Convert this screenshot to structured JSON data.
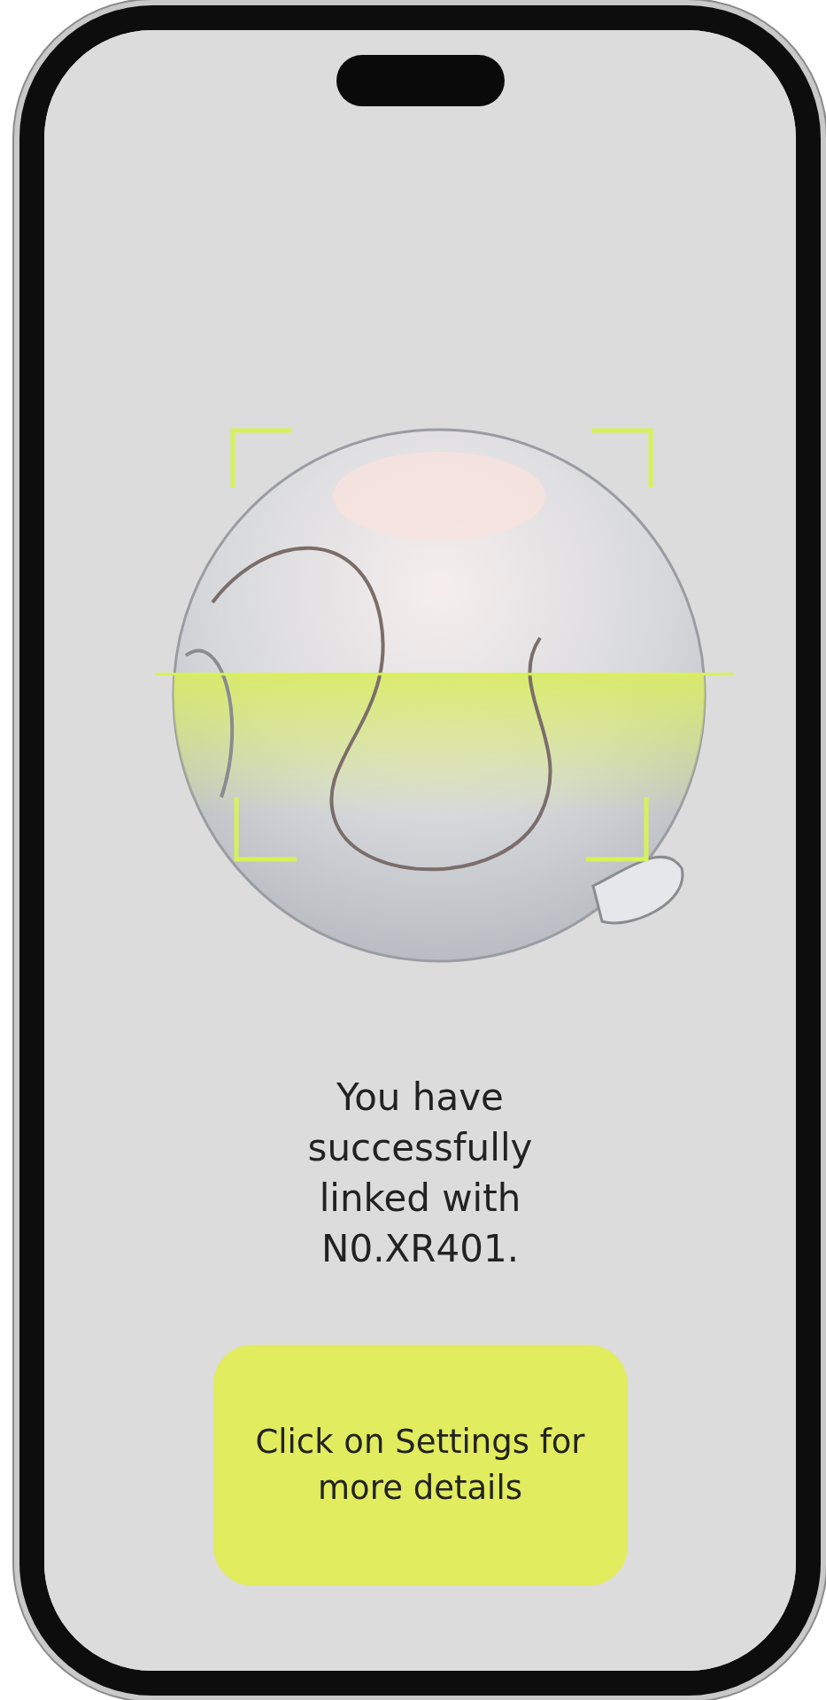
{
  "message": "You have successfully linked with N0.XR401.",
  "button": {
    "label": "Click on Settings for more details"
  }
}
